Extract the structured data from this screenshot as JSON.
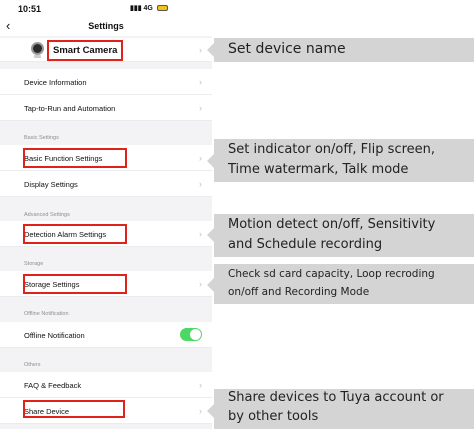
{
  "status": {
    "time": "10:51",
    "signal": "4G"
  },
  "nav": {
    "title": "Settings"
  },
  "device": {
    "name": "Smart Camera"
  },
  "rows": {
    "device_information": "Device Information",
    "tap_to_run": "Tap-to-Run and Automation",
    "basic_function": "Basic Function Settings",
    "display": "Display Settings",
    "detection_alarm": "Detection Alarm Settings",
    "storage_settings": "Storage Settings",
    "offline_notification": "Offline Notification",
    "faq": "FAQ & Feedback",
    "share_device": "Share Device"
  },
  "sections": {
    "basic": "Basic Settings",
    "advanced": "Advanced Settings",
    "storage": "Storage",
    "offline": "Offline Notification",
    "others": "Others"
  },
  "toggles": {
    "offline_notification_on": true
  },
  "callouts": {
    "device_name": "Set device name",
    "basic_line1": "Set indicator on/off, Flip screen,",
    "basic_line2": "Time watermark, Talk mode",
    "detection_line1": "Motion detect on/off, Sensitivity",
    "detection_line2": "and Schedule recording",
    "storage_line1": "Check sd card capacity, Loop recroding",
    "storage_line2": "on/off and Recording Mode",
    "share_line1": "Share devices to Tuya account or",
    "share_line2": "by other tools"
  },
  "colors": {
    "highlight": "#e0221b",
    "toggle_on": "#4bd863",
    "callout_bg": "#d4d4d4"
  }
}
